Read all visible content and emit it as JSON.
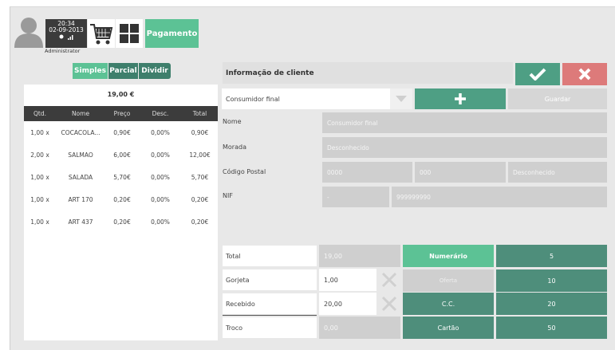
{
  "header": {
    "time": "20:34",
    "date": "02-09-2013",
    "user": "Administrator",
    "payment_tab": "Pagamento"
  },
  "order": {
    "modes": [
      "Simples",
      "Parcial",
      "Dividir"
    ],
    "total": "19,00 €",
    "columns": [
      "Qtd.",
      "Nome",
      "Preço",
      "Desc.",
      "Total"
    ],
    "rows": [
      [
        "1,00 x",
        "COCACOLA...",
        "0,90€",
        "0,00%",
        "0,90€"
      ],
      [
        "2,00 x",
        "SALMAO",
        "6,00€",
        "0,00%",
        "12,00€"
      ],
      [
        "1,00 x",
        "SALADA",
        "5,70€",
        "0,00%",
        "5,70€"
      ],
      [
        "1,00 x",
        "ART 170",
        "0,20€",
        "0,00%",
        "0,20€"
      ],
      [
        "1,00 x",
        "ART 437",
        "0,20€",
        "0,00%",
        "0,20€"
      ]
    ]
  },
  "customer": {
    "title": "Informação de cliente",
    "selected": "Consumidor final",
    "save_label": "Guardar",
    "labels": {
      "name": "Nome",
      "address": "Morada",
      "postal": "Código Postal",
      "nif": "NIF"
    },
    "values": {
      "name": "Consumidor final",
      "address": "Desconhecido",
      "postal1": "0000",
      "postal2": "000",
      "city": "Desconhecido",
      "nif_prefix": "-",
      "nif": "999999990"
    }
  },
  "totals": {
    "labels": [
      "Total",
      "Gorjeta",
      "Recebido",
      "Troco"
    ],
    "values": [
      "19,00",
      "1,00",
      "20,00",
      "0,00"
    ]
  },
  "payment_methods": [
    "Numerário",
    "Oferta",
    "C.C.",
    "Cartão"
  ],
  "quick_amounts": [
    "5",
    "10",
    "20",
    "50"
  ],
  "colors": {
    "accent": "#5cc295",
    "dark_green": "#4e8e7b",
    "cancel": "#dd7a7a"
  }
}
